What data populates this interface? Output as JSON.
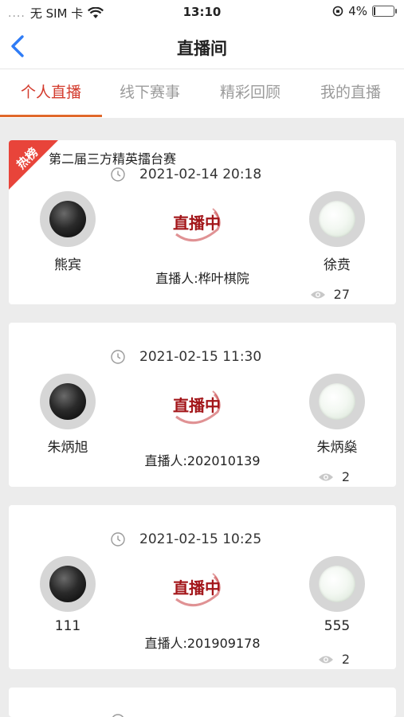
{
  "status_bar": {
    "carrier": "无 SIM 卡",
    "signal_dots": "....",
    "time": "13:10",
    "battery_percent": "4%",
    "battery_level": 0.04
  },
  "navbar": {
    "title": "直播间"
  },
  "tabs": [
    {
      "label": "个人直播",
      "active": true
    },
    {
      "label": "线下赛事",
      "active": false
    },
    {
      "label": "精彩回顾",
      "active": false
    },
    {
      "label": "我的直播",
      "active": false
    }
  ],
  "streams": [
    {
      "badge": "热榜",
      "event_name": "第二届三方精英擂台赛",
      "time": "2021-02-14 20:18",
      "black_player": "熊宾",
      "white_player": "徐贲",
      "live_label": "直播中",
      "streamer": "直播人:桦叶棋院",
      "views": "27"
    },
    {
      "badge": "",
      "event_name": "",
      "time": "2021-02-15 11:30",
      "black_player": "朱炳旭",
      "white_player": "朱炳燊",
      "live_label": "直播中",
      "streamer": "直播人:202010139",
      "views": "2"
    },
    {
      "badge": "",
      "event_name": "",
      "time": "2021-02-15 10:25",
      "black_player": "111",
      "white_player": "555",
      "live_label": "直播中",
      "streamer": "直播人:201909178",
      "views": "2"
    }
  ],
  "colors": {
    "accent": "#d33a2c",
    "tab_underline": "#e0682a",
    "badge": "#e8443a",
    "live_stamp": "#a3161a",
    "back_arrow": "#2f7cf6"
  }
}
